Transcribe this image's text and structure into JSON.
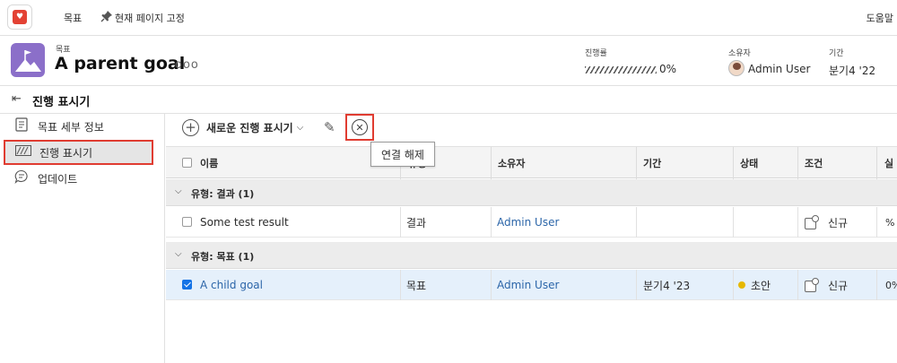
{
  "topbar": {
    "logo_glyph": "♥",
    "nav_goals": "목표",
    "nav_pin": "현재 페이지 고정",
    "help": "도움말"
  },
  "header": {
    "kind": "목표",
    "title": "A parent goal",
    "more": "ooo",
    "progress_label": "진행률",
    "progress_value": "0%",
    "owner_label": "소유자",
    "owner_value": "Admin User",
    "period_label": "기간",
    "period_value": "분기4 '22"
  },
  "section": {
    "title": "진행 표시기"
  },
  "leftnav": {
    "items": [
      {
        "label": "목표 세부 정보",
        "icon": "document-icon"
      },
      {
        "label": "진행 표시기",
        "icon": "progress-indicator-icon",
        "active": true
      },
      {
        "label": "업데이트",
        "icon": "comment-icon"
      }
    ]
  },
  "toolbar": {
    "add_label": "새로운 진행 표시기",
    "tooltip": "연결 해제"
  },
  "table": {
    "columns": [
      "이름",
      "유형",
      "소유자",
      "기간",
      "상태",
      "조건",
      "실"
    ],
    "groups": [
      {
        "label": "유형: 결과 (1)",
        "rows": [
          {
            "name": "Some test result",
            "type": "결과",
            "owner": "Admin User",
            "period": "",
            "status": "",
            "condition": "신규",
            "extra": "%",
            "checked": false
          }
        ]
      },
      {
        "label": "유형: 목표 (1)",
        "rows": [
          {
            "name": "A child goal",
            "type": "목표",
            "owner": "Admin User",
            "period": "분기4 '23",
            "status": "초안",
            "condition": "신규",
            "extra": "0%",
            "checked": true
          }
        ]
      }
    ]
  },
  "colors": {
    "accent": "#e03c31",
    "brand_purple": "#8b6fc9",
    "link": "#2b65a8",
    "status_draft": "#e6b800",
    "checkbox_blue": "#1473e6"
  }
}
